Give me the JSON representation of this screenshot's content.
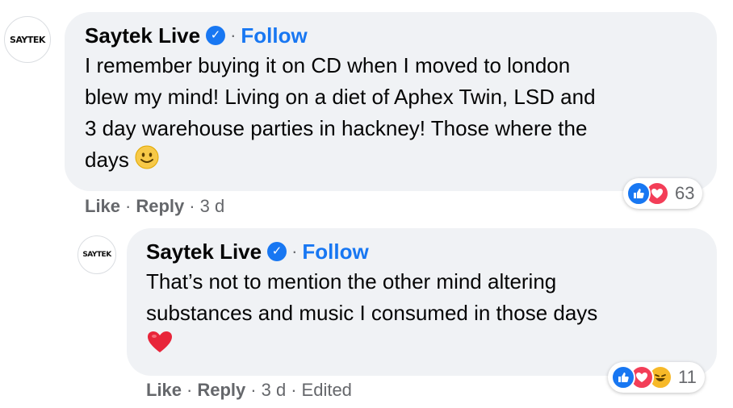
{
  "comment1": {
    "avatar_text": "SAYTEK",
    "author": "Saytek Live",
    "separator": "·",
    "follow_label": "Follow",
    "text_lines": [
      "I remember buying it on CD when I moved to london",
      "blew my mind! Living on a diet of Aphex Twin, LSD and",
      "3 day warehouse parties in hackney! Those where the",
      "days"
    ],
    "like_label": "Like",
    "reply_label": "Reply",
    "time": "3 d",
    "reaction_count": "63",
    "reactions": [
      "like-icon",
      "love-icon"
    ]
  },
  "comment2": {
    "avatar_text": "SAYTEK",
    "author": "Saytek Live",
    "separator": "·",
    "follow_label": "Follow",
    "text_lines": [
      "That’s not to mention the other mind altering",
      "substances and music I consumed in those days"
    ],
    "like_label": "Like",
    "reply_label": "Reply",
    "time": "3 d",
    "edited_label": "Edited",
    "reaction_count": "11",
    "reactions": [
      "like-icon",
      "love-icon",
      "haha-icon"
    ]
  },
  "colors": {
    "accent": "#1877f2",
    "bubble": "#f0f2f5",
    "meta": "#65676b",
    "love": "#f33e58",
    "haha": "#f7b928"
  }
}
